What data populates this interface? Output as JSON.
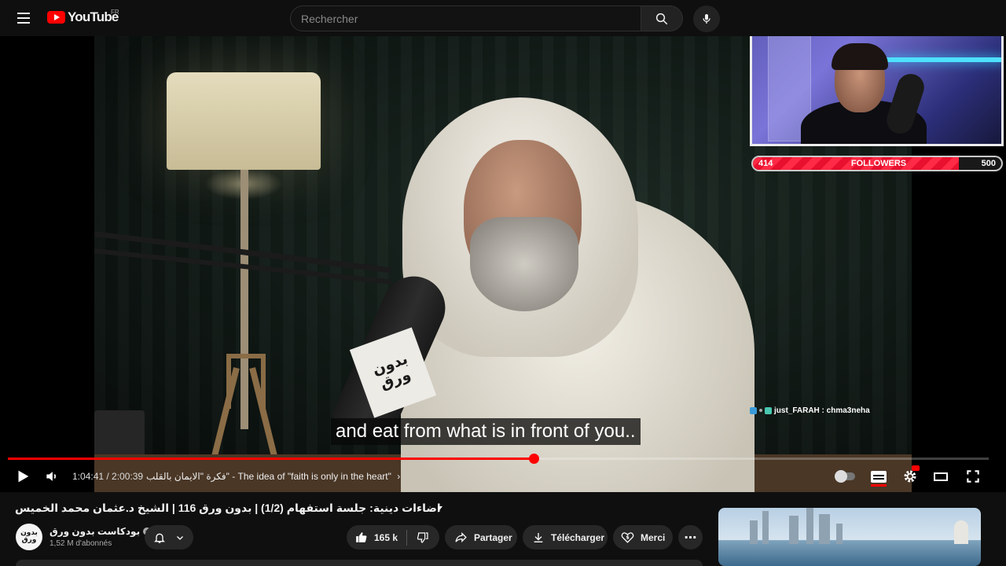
{
  "header": {
    "logo_text": "YouTube",
    "country_code": "FR",
    "search_placeholder": "Rechercher",
    "icons": [
      "menu-icon",
      "search-icon",
      "mic-icon"
    ]
  },
  "video": {
    "subtitle": "and eat from what is in front of you..",
    "current_time": "1:04:41",
    "duration": "2:00:39",
    "time_display": "1:04:41 / 2:00:39",
    "progress_played": 0.536,
    "chapter_arabic": "فكرة \"الايمان بالقلب\"",
    "chapter_english": "The idea of \"faith is only in the heart\"",
    "chapter_display": "فكرة \"الايمان بالقلب\" - The idea of \"faith is only in the heart\"",
    "mic_badge_line1": "بدون",
    "mic_badge_line2": "ورق",
    "accent": "#ff0000"
  },
  "overlay": {
    "followers_current": "414",
    "followers_label": "FOLLOWERS",
    "followers_goal": "500",
    "followers_fraction": 0.828,
    "chat_user": "just_FARAH",
    "chat_message": "chma3neha",
    "chat_line": "just_FARAH : chma3neha"
  },
  "meta": {
    "title": "اضاءات دينية: جلسة استفهام (1/2) | بدون ورق 116 | الشيخ د.عثمان محمد الخميس",
    "channel_name": "بودكاست بدون ورق",
    "channel_avatar_line1": "بدون",
    "channel_avatar_line2": "ورق",
    "subscribers": "1,52 M d'abonnés",
    "like_count": "165 k",
    "share_label": "Partager",
    "download_label": "Télécharger",
    "thanks_label": "Merci"
  },
  "colors": {
    "background": "#0f0f0f",
    "pill": "#272727",
    "followers_fill": "#ff2a45"
  }
}
